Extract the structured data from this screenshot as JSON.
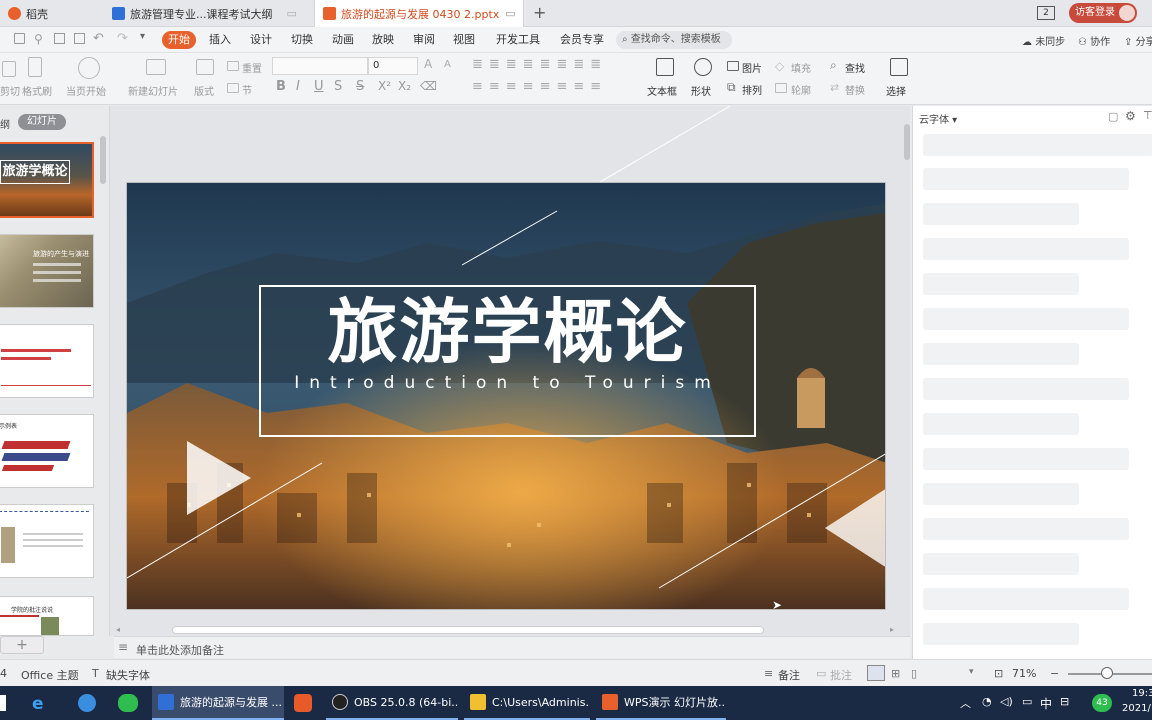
{
  "tabs": [
    {
      "label": "稻壳"
    },
    {
      "label": "旅游管理专业...课程考试大纲"
    },
    {
      "label": "旅游的起源与发展 0430 2.pptx"
    }
  ],
  "titlebar": {
    "page_indicator": "2",
    "login": "访客登录",
    "new_tab": "+"
  },
  "menu": [
    "开始",
    "插入",
    "设计",
    "切换",
    "动画",
    "放映",
    "审阅",
    "视图",
    "开发工具",
    "会员专享"
  ],
  "search": {
    "placeholder": "查找命令、搜索模板"
  },
  "menu_right": {
    "sync": "未同步",
    "collab": "协作",
    "share": "分享"
  },
  "ribbon": {
    "cut": "剪切",
    "format_painter": "格式刷",
    "from_current": "当页开始",
    "new_slide": "新建幻灯片",
    "layout": "版式",
    "section": "节",
    "reset": "重置",
    "font_size": "0",
    "textbox": "文本框",
    "shape": "形状",
    "picture": "图片",
    "arrange": "排列",
    "fill": "填充",
    "outline": "轮廓",
    "find": "查找",
    "replace": "替换",
    "select": "选择"
  },
  "left": {
    "outline_tab": "纲",
    "slides_tab": "幻灯片"
  },
  "thumbs": {
    "t1": "旅游学概论",
    "t2": "旅游的产生与演进",
    "t4": "示例表",
    "t6": "学院的批注说说"
  },
  "slide": {
    "title": "旅游学概论",
    "subtitle": "Introduction to Tourism"
  },
  "notes": {
    "placeholder": "单击此处添加备注"
  },
  "rightpanel": {
    "title": "云字体"
  },
  "status": {
    "slide_num": "4",
    "theme": "Office 主题",
    "missing_font": "缺失字体",
    "notes": "备注",
    "comments": "批注",
    "zoom": "71%"
  },
  "taskbar": {
    "items": [
      "旅游的起源与发展 ...",
      "OBS 25.0.8 (64-bi...",
      "C:\\Users\\Adminis...",
      "WPS演示 幻灯片放..."
    ],
    "tray_ime": "中",
    "tray_badge": "43",
    "clock_time": "19:3",
    "clock_date": "2021/"
  },
  "colors": {
    "accent": "#e8602c",
    "taskbar": "#1a2a44"
  }
}
